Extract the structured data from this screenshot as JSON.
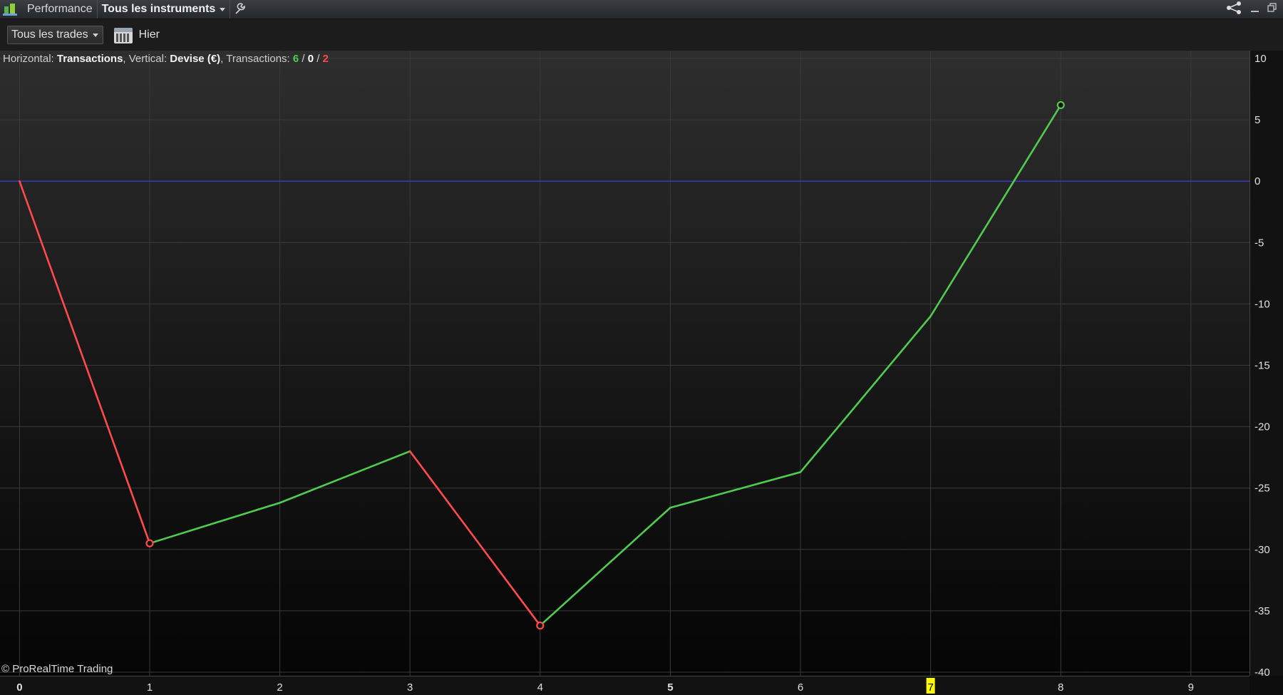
{
  "titlebar": {
    "tab_performance": "Performance",
    "tab_instruments": "Tous les instruments",
    "wrench_icon": "wrench-icon",
    "share_icon": "share-icon",
    "minimize_icon": "minimize-icon",
    "restore_icon": "restore-icon"
  },
  "toolbar": {
    "trades_dropdown": "Tous les trades",
    "calendar_icon": "calendar-icon",
    "date_label": "Hier"
  },
  "legend": {
    "horizontal_label": "Horizontal: ",
    "horizontal_value": "Transactions",
    "vertical_label": ", Vertical: ",
    "vertical_value": "Devise (€)",
    "transactions_label": ", Transactions: ",
    "wins": "6",
    "sep1": " / ",
    "neutral": "0",
    "sep2": " / ",
    "losses": "2"
  },
  "copyright": "© ProRealTime Trading",
  "colors": {
    "gain": "#4fcb4f",
    "loss": "#ff4a4a",
    "zero_line": "#3a3ad0",
    "grid": "#3a3a3a",
    "highlight": "#ffff00"
  },
  "chart_data": {
    "type": "line",
    "xlabel": "Transactions",
    "ylabel": "Devise (€)",
    "x": [
      0,
      1,
      2,
      3,
      4,
      5,
      6,
      7,
      8
    ],
    "y": [
      0,
      -29.5,
      -26.2,
      -22.0,
      -36.2,
      -26.6,
      -23.7,
      -11.0,
      6.2
    ],
    "segment_colors": [
      "loss",
      "gain",
      "gain",
      "loss",
      "gain",
      "gain",
      "gain",
      "gain"
    ],
    "markers": [
      1,
      4,
      8
    ],
    "xlim": [
      -0.15,
      9.45
    ],
    "ylim": [
      -40,
      10
    ],
    "x_ticks": [
      "0",
      "1",
      "2",
      "3",
      "4",
      "5",
      "6",
      "7",
      "8",
      "9"
    ],
    "x_tick_bold": [
      "0",
      "5"
    ],
    "x_tick_highlight": "7",
    "y_ticks": [
      "10",
      "5",
      "0",
      "-5",
      "-10",
      "-15",
      "-20",
      "-25",
      "-30",
      "-35",
      "-40"
    ],
    "zero_line": 0,
    "grid": true
  }
}
